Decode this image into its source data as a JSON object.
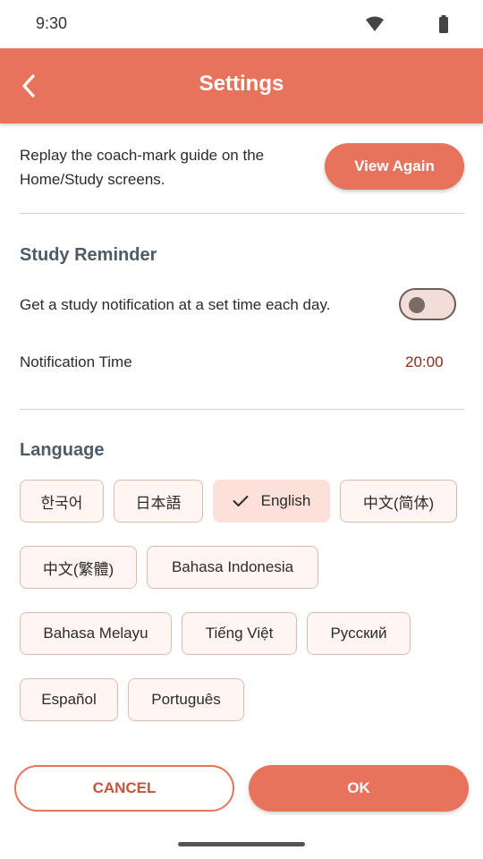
{
  "status_bar": {
    "time": "9:30",
    "wifi_icon": "wifi-icon",
    "battery_icon": "battery-icon"
  },
  "app_bar": {
    "title": "Settings",
    "back_icon": "chevron-left-icon"
  },
  "guide": {
    "text": "Replay the coach-mark guide on the Home/Study screens.",
    "button_label": "View Again"
  },
  "reminder": {
    "title": "Study Reminder",
    "text": "Get a study notification at a set time each day.",
    "enabled": false,
    "time_label": "Notification Time",
    "time_value": "20:00"
  },
  "language": {
    "title": "Language",
    "selected": "English",
    "options": [
      "한국어",
      "日本語",
      "English",
      "中文(简体)",
      "中文(繁體)",
      "Bahasa Indonesia",
      "Bahasa Melayu",
      "Tiếng Việt",
      "Русский",
      "Español",
      "Português"
    ]
  },
  "actions": {
    "cancel_label": "CANCEL",
    "ok_label": "OK"
  },
  "colors": {
    "accent": "#E8735C",
    "chip_selected": "#FDE0D9",
    "time_text": "#8B2B1B"
  }
}
